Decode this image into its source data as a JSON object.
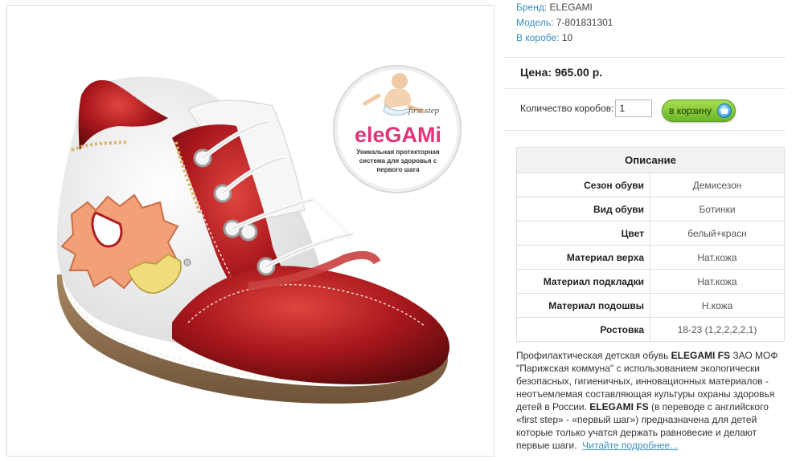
{
  "product": {
    "brand_label": "Бренд:",
    "brand": "ELEGAMI",
    "model_label": "Модель:",
    "model": "7-801831301",
    "box_label": "В коробе:",
    "box_qty": "10"
  },
  "price_text": "Цена: 965.00 р.",
  "order": {
    "qty_label": "Количество коробов:",
    "qty_value": "1",
    "cart_button": "в корзину"
  },
  "description": {
    "title": "Описание",
    "rows": [
      {
        "key": "Сезон обуви",
        "value": "Демисезон"
      },
      {
        "key": "Вид обуви",
        "value": "Ботинки"
      },
      {
        "key": "Цвет",
        "value": "белый+красн"
      },
      {
        "key": "Материал верха",
        "value": "Нат.кожа"
      },
      {
        "key": "Материал подкладки",
        "value": "Нат.кожа"
      },
      {
        "key": "Материал подошвы",
        "value": "Н.кожа"
      },
      {
        "key": "Ростовка",
        "value": "18-23 (1,2,2,2,2,1)"
      }
    ]
  },
  "about": {
    "p1": "Профилактическая детская обувь ",
    "b1": "ELEGAMI FS",
    "p2": " ЗАО МОФ \"Парижская коммуна\" с использованием экологически безопасных, гигиеничных, инновационных материалов - неотъемлемая составляющая культуры охраны здоровья детей в России. ",
    "b2": "ELEGAMI FS",
    "p3": " (в переводе с английского «first step» - «первый шаг») предназначена для детей которые только учатся держать равновесие и делают первые шаги.",
    "more": "Читайте подробнее..."
  },
  "logo": {
    "tag": "first step",
    "brand": "eleGAMi",
    "line1": "Уникальная протекторная",
    "line2": "система для здоровья с",
    "line3": "первого шага"
  },
  "colors": {
    "link": "#3c8ec1",
    "shoe_red": "#a8171c",
    "cart_green": "#7dc23a"
  }
}
